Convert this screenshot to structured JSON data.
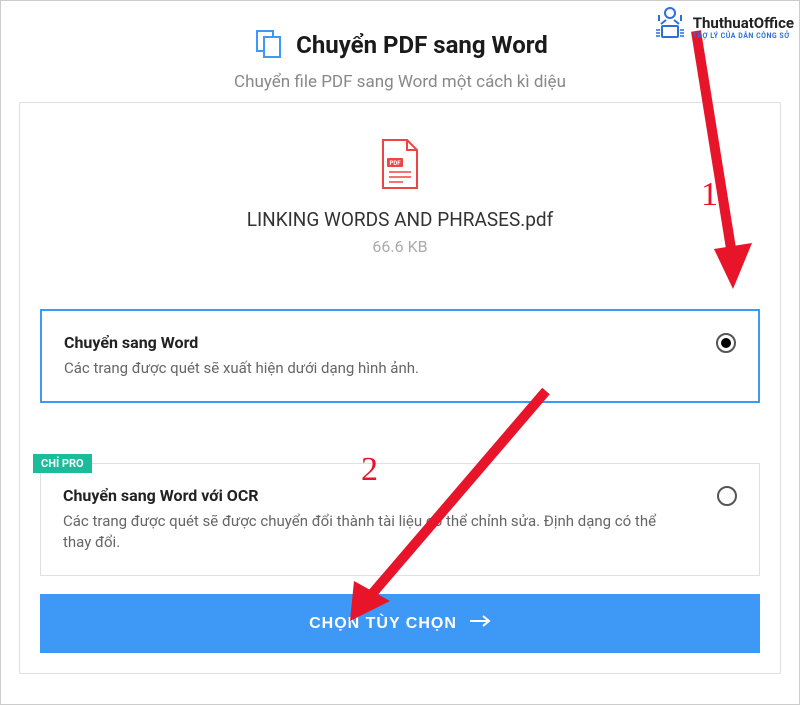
{
  "watermark": {
    "brand": "ThuthuatOffice",
    "sub": "TRỢ LÝ CỦA DÂN CÔNG SỞ"
  },
  "header": {
    "title": "Chuyển PDF sang Word",
    "subtitle": "Chuyển file PDF sang Word một cách kì diệu"
  },
  "file": {
    "name": "LINKING WORDS AND PHRASES.pdf",
    "size": "66.6 KB"
  },
  "options": [
    {
      "title": "Chuyển sang Word",
      "desc": "Các trang được quét sẽ xuất hiện dưới dạng hình ảnh.",
      "selected": true,
      "pro": false
    },
    {
      "title": "Chuyển sang Word với OCR",
      "desc": "Các trang được quét sẽ được chuyển đổi thành tài liệu có thể chỉnh sửa. Định dạng có thể thay đổi.",
      "selected": false,
      "pro": true
    }
  ],
  "pro_badge_label": "CHỈ PRO",
  "action_button": "CHỌN TÙY CHỌN",
  "annotations": {
    "n1": "1",
    "n2": "2"
  }
}
